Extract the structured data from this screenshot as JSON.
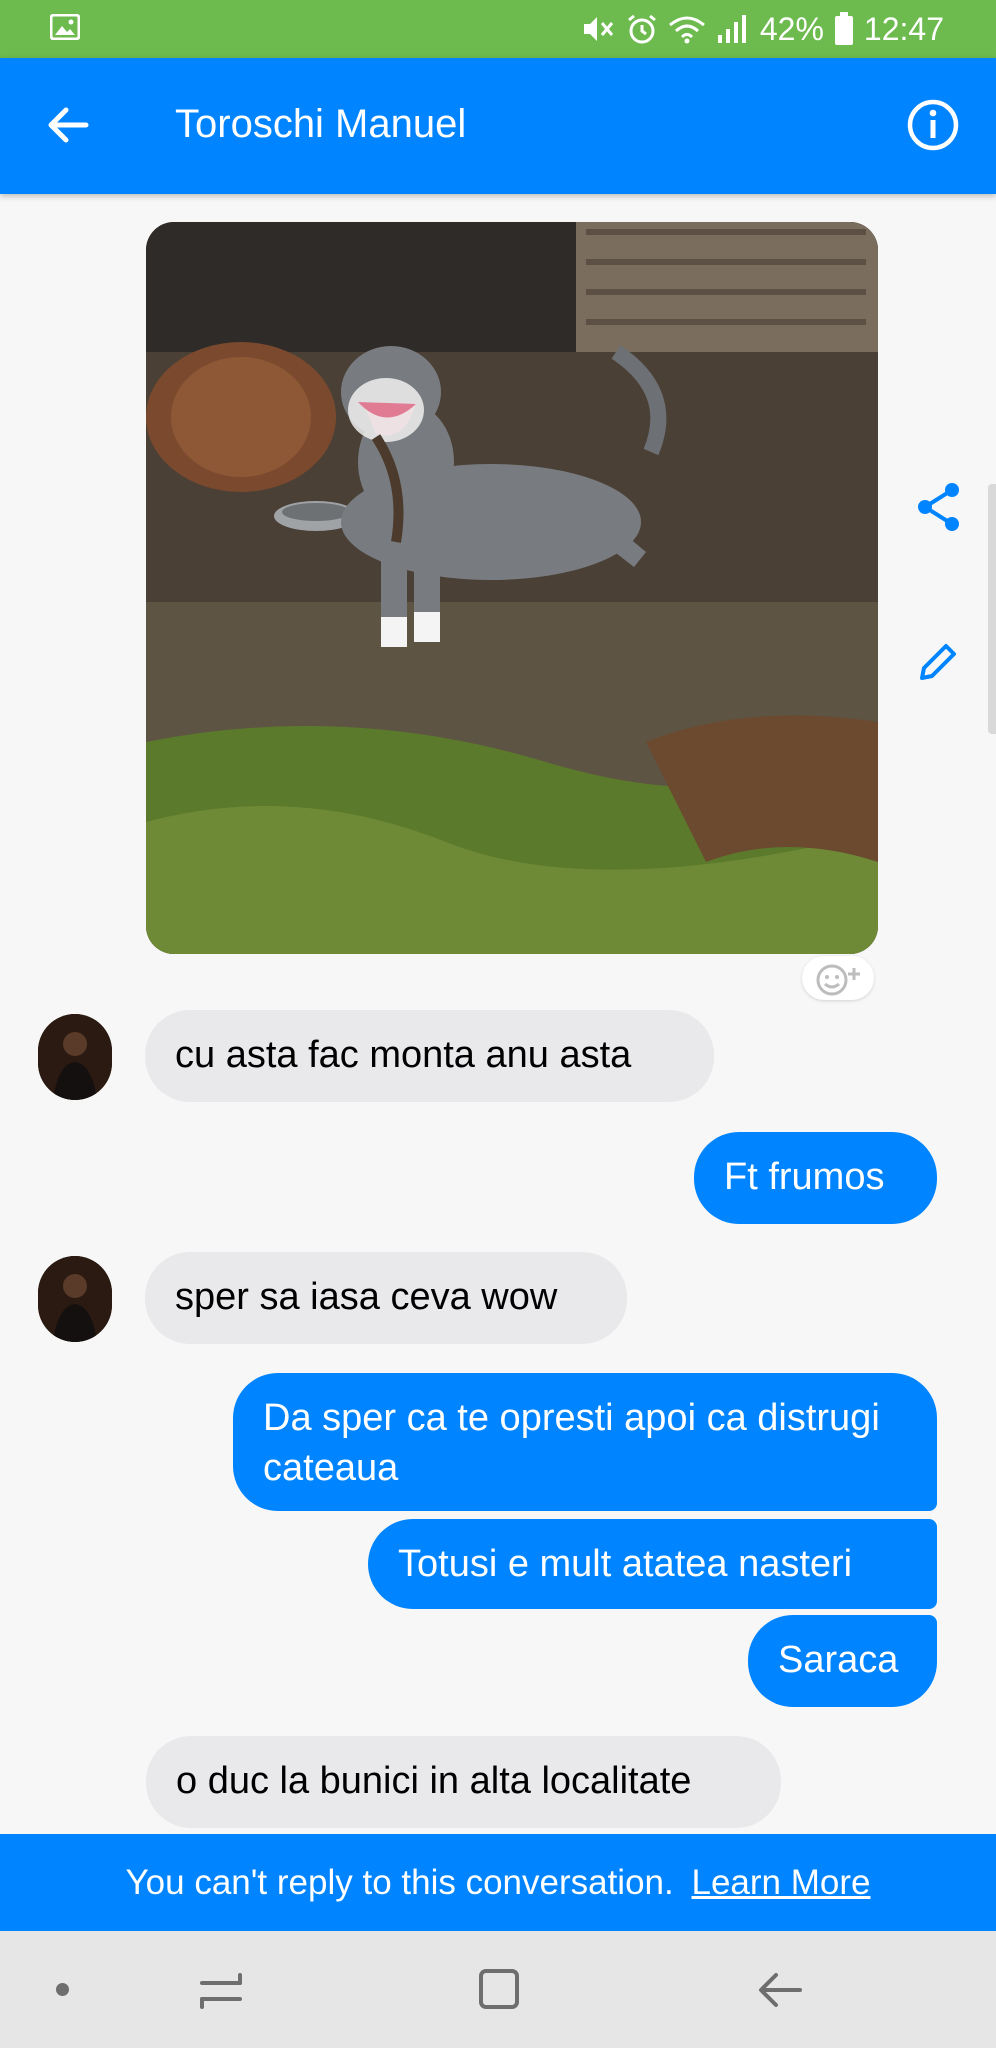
{
  "status_bar": {
    "battery": "42%",
    "time": "12:47",
    "icons": [
      "gallery-icon",
      "mute-icon",
      "alarm-icon",
      "wifi-icon",
      "signal-icon",
      "battery-icon"
    ],
    "background": "#6dbb4f"
  },
  "header": {
    "title": "Toroschi Manuel",
    "back_icon": "arrow-left-icon",
    "info_icon": "info-icon",
    "background": "#0084ff"
  },
  "photo": {
    "description_icon": "dog-photo",
    "reaction_icon": "add-reaction-icon",
    "actions": [
      "share-icon",
      "edit-icon"
    ]
  },
  "messages": [
    {
      "direction": "in",
      "text": "cu asta fac monta anu asta"
    },
    {
      "direction": "out",
      "text": "Ft frumos"
    },
    {
      "direction": "in",
      "text": "sper sa iasa ceva wow"
    },
    {
      "direction": "out",
      "text": "Da sper ca te opresti apoi ca distrugi cateaua"
    },
    {
      "direction": "out",
      "text": "Totusi e mult atatea nasteri"
    },
    {
      "direction": "out",
      "text": "Saraca"
    },
    {
      "direction": "in",
      "text": "o duc la bunici in alta localitate"
    }
  ],
  "reply_bar": {
    "text": "You can't reply to this conversation.",
    "link": "Learn More"
  },
  "colors": {
    "incoming_bubble": "#e9e9eb",
    "outgoing_bubble": "#0084ff"
  }
}
